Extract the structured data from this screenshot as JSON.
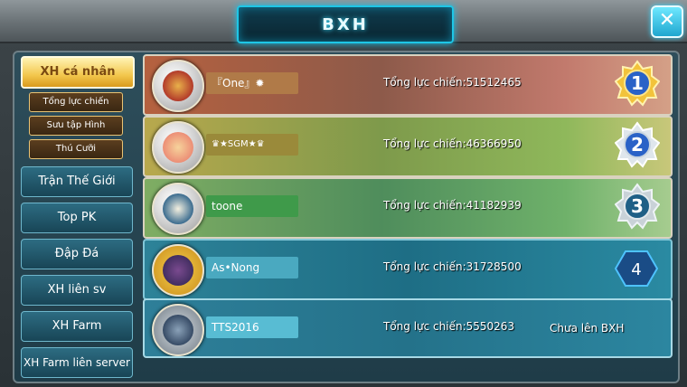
{
  "header": {
    "title": "BXH",
    "close_icon": "close-icon"
  },
  "sidebar": {
    "active": "XH cá nhân",
    "sub_items": [
      "Tổng lực chiến",
      "Sưu tập Hình",
      "Thú Cưỡi"
    ],
    "items": [
      "Trận Thế Giới",
      "Top PK",
      "Đập Đá",
      "XH liên sv",
      "XH Farm",
      "XH Farm liên server"
    ]
  },
  "rankings": [
    {
      "rank": "1",
      "name": "『One』✹",
      "power": "Tổng lực chiến:51512465",
      "name_color": "#b07a48"
    },
    {
      "rank": "2",
      "name": "♛★SGM★♛",
      "power": "Tổng lực chiến:46366950",
      "name_color": "#9a8a3a"
    },
    {
      "rank": "3",
      "name": "toone",
      "power": "Tổng lực chiến:41182939",
      "name_color": "#3f9a4a"
    },
    {
      "rank": "4",
      "name": "As•Nong",
      "power": "Tổng lực chiến:31728500",
      "name_color": "#4aa9c0"
    }
  ],
  "self": {
    "name": "TTS2016",
    "power": "Tổng lực chiến:5550263",
    "status": "Chưa lên BXH",
    "name_color": "#58bcd3"
  }
}
